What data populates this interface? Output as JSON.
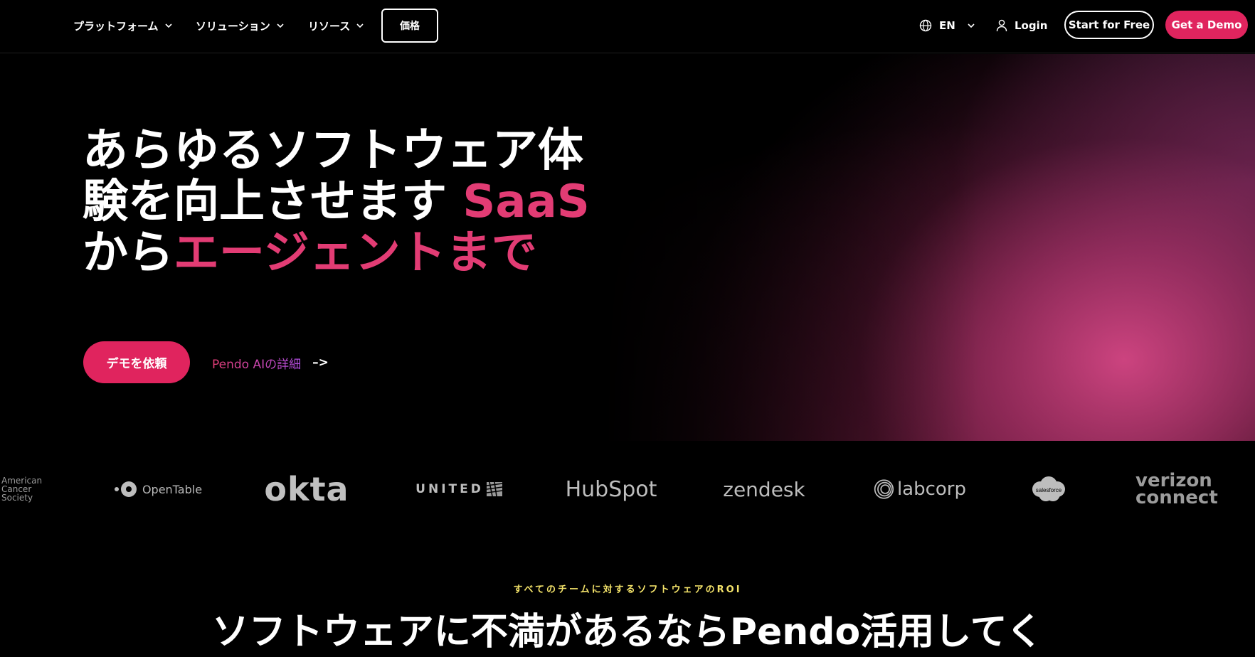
{
  "nav": {
    "items": [
      {
        "label": "プラットフォーム"
      },
      {
        "label": "ソリューション"
      },
      {
        "label": "リソース"
      }
    ],
    "pricing_label": "価格",
    "language_label": "EN",
    "login_label": "Login",
    "start_label": "Start for Free",
    "demo_label": "Get a Demo"
  },
  "hero": {
    "title_line1": "あらゆるソフトウェア体",
    "title_line2a": "験を向上させます ",
    "title_line2b": "SaaS",
    "title_line3a": "から",
    "title_line3b": "エージェントまで",
    "cta_primary": "デモを依頼",
    "cta_link": "Pendo AIの詳細",
    "cta_arrow": "–>"
  },
  "logos": {
    "acs": [
      "American",
      "Cancer",
      "Society"
    ],
    "opentable": "OpenTable",
    "okta": "okta",
    "united": "UNITED",
    "hubspot": "HubSpot",
    "zendesk": "zendesk",
    "labcorp": "labcorp",
    "salesforce": "salesforce",
    "verizon": [
      "verizon",
      "connect"
    ]
  },
  "section": {
    "eyebrow": "すべてのチームに対するソフトウェアのROI",
    "title": "ソフトウェアに不満があるならPendo活用してく"
  },
  "colors": {
    "accent_pink": "#e0245e",
    "title_pink": "#e23c74",
    "eyebrow_yellow": "#f4e36a",
    "link_purple": "#b34fe6"
  }
}
